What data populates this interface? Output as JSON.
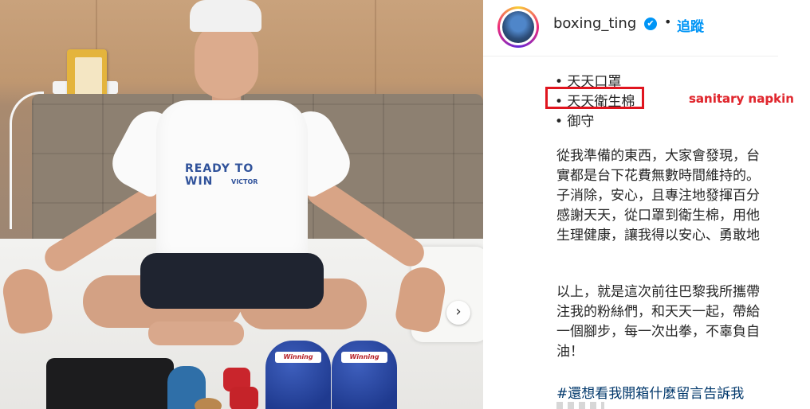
{
  "post": {
    "username": "boxing_ting",
    "verified_symbol": "✔",
    "separator": "•",
    "follow_label": "追蹤",
    "next_symbol": "›"
  },
  "photo": {
    "shirt_text": "READY TO WIN",
    "shirt_sub": "VICTOR",
    "glove_label": "Winning"
  },
  "caption": {
    "bullets": [
      "• 天天口罩",
      "• 天天衛生棉",
      "• 御守"
    ],
    "paragraph1": [
      "從我準備的東西，大家會發現，台",
      "實都是台下花費無數時間維持的。",
      "子消除，安心，且專注地發揮百分",
      "感謝天天，從口罩到衛生棉，用他",
      "生理健康，讓我得以安心、勇敢地"
    ],
    "paragraph2": [
      "以上，就是這次前往巴黎我所攜帶",
      "注我的粉絲們，和天天一起，帶給",
      "一個腳步，每一次出拳，不辜負自",
      "油！"
    ],
    "hashtag": "#還想看我開箱什麼留言告訴我"
  },
  "annotation": {
    "label": "sanitary napkin",
    "color": "#e0151f"
  },
  "colors": {
    "link": "#0095f6",
    "text": "#262626"
  }
}
